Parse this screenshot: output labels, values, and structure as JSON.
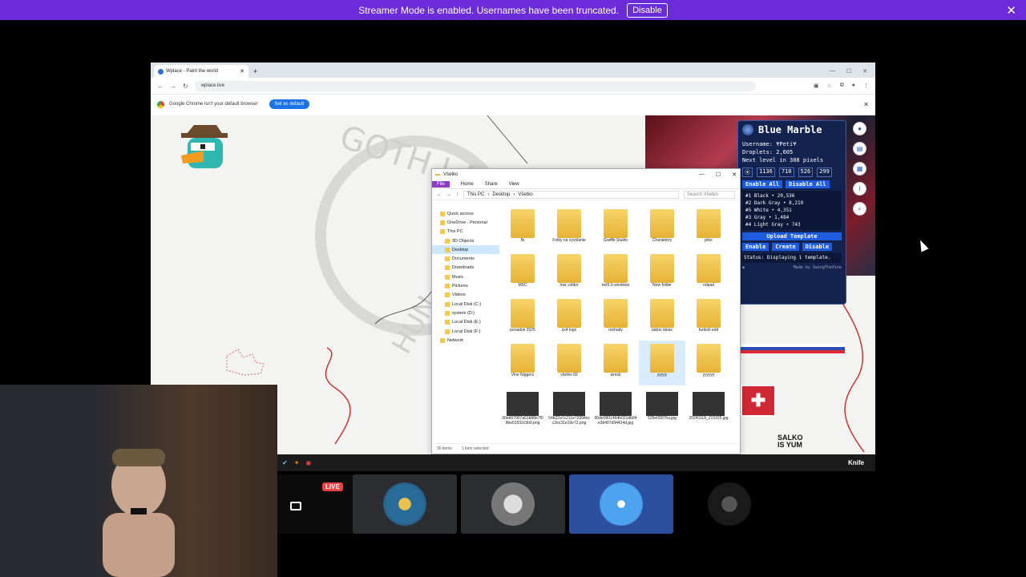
{
  "banner": {
    "text": "Streamer Mode is enabled. Usernames have been truncated.",
    "button": "Disable",
    "close": "✕"
  },
  "browser": {
    "tab_title": "Wplace - Paint the world",
    "url": "wplace.live",
    "infobar_text": "Google Chrome isn't your default browser",
    "infobar_button": "Set as default"
  },
  "map": {
    "watermark_top": "GOTH LAND",
    "watermark_side": "HUN",
    "salko": [
      "SALKO",
      "IS YUM"
    ],
    "crest": "✚"
  },
  "blue_marble": {
    "title": "Blue Marble",
    "username": "Username: ¥Peti¥",
    "droplets": "Droplets: 2,605",
    "next_level": "Next level in 308 pixels",
    "coords": [
      "1136",
      "710",
      "526",
      "299"
    ],
    "enable_all": "Enable All",
    "disable_all": "Disable All",
    "colors": [
      "#1 Black • 20,536",
      "#2 Dark Gray • 8,219",
      "#5 White • 4,351",
      "#3 Gray • 1,484",
      "#4 Light Gray • 743"
    ],
    "upload": "Upload Template",
    "enable": "Enable",
    "create": "Create",
    "disable": "Disable",
    "status": "Status: Displaying 1 template.",
    "footer": "Made by SwingTheVine"
  },
  "explorer": {
    "title": "Všetko",
    "ribbon": [
      "File",
      "Home",
      "Share",
      "View"
    ],
    "path": [
      "This PC",
      "Desktop",
      "Všetko"
    ],
    "search_placeholder": "Search Všetko",
    "sidebar": [
      {
        "label": "Quick access",
        "sub": false,
        "sel": false
      },
      {
        "label": "OneDrive - Personal",
        "sub": false,
        "sel": false
      },
      {
        "label": "This PC",
        "sub": false,
        "sel": false
      },
      {
        "label": "3D Objects",
        "sub": true,
        "sel": false
      },
      {
        "label": "Desktop",
        "sub": true,
        "sel": true
      },
      {
        "label": "Documents",
        "sub": true,
        "sel": false
      },
      {
        "label": "Downloads",
        "sub": true,
        "sel": false
      },
      {
        "label": "Music",
        "sub": true,
        "sel": false
      },
      {
        "label": "Pictures",
        "sub": true,
        "sel": false
      },
      {
        "label": "Videos",
        "sub": true,
        "sel": false
      },
      {
        "label": "Local Disk (C:)",
        "sub": true,
        "sel": false
      },
      {
        "label": "system (D:)",
        "sub": true,
        "sel": false
      },
      {
        "label": "Local Disk (E:)",
        "sub": true,
        "sel": false
      },
      {
        "label": "Local Disk (F:)",
        "sub": true,
        "sel": false
      },
      {
        "label": "Network",
        "sub": false,
        "sel": false
      }
    ],
    "items": [
      {
        "name": "flx",
        "kind": "folder"
      },
      {
        "name": "Fotky na vyvolanie",
        "kind": "folder"
      },
      {
        "name": "Graffiti Studio",
        "kind": "folder"
      },
      {
        "name": "Charaktery",
        "kind": "folder"
      },
      {
        "name": "jebe",
        "kind": "folder"
      },
      {
        "name": "MSC",
        "kind": "folder"
      },
      {
        "name": "msc editor",
        "kind": "folder"
      },
      {
        "name": "net6.0-windows",
        "kind": "folder"
      },
      {
        "name": "New folder",
        "kind": "folder"
      },
      {
        "name": "odpad",
        "kind": "folder"
      },
      {
        "name": "ponadok 2025",
        "kind": "folder"
      },
      {
        "name": "ps4 logo",
        "kind": "folder"
      },
      {
        "name": "reshady",
        "kind": "folder"
      },
      {
        "name": "tattoo ideas",
        "kind": "folder"
      },
      {
        "name": "turkish edit",
        "kind": "folder"
      },
      {
        "name": "Vine Niggerz",
        "kind": "folder"
      },
      {
        "name": "všetko 69",
        "kind": "folder"
      },
      {
        "name": "wreck",
        "kind": "folder"
      },
      {
        "name": "yyyyy",
        "kind": "folder",
        "selected": true
      },
      {
        "name": "yyyyyy",
        "kind": "folder"
      },
      {
        "name": "30eb57907a61b88e7f09be01532c5b9.png",
        "kind": "image"
      },
      {
        "name": "54b22a7c211e73394ccc2ec31e19e72.png",
        "kind": "image"
      },
      {
        "name": "90de0901464b021db04e3b407d94424d.jpg",
        "kind": "image"
      },
      {
        "name": "525e00076a.jpg",
        "kind": "image"
      },
      {
        "name": "20241118_215325.jpg",
        "kind": "image"
      }
    ],
    "status_count": "30 items",
    "status_sel": "1 item selected"
  },
  "taskstrip": {
    "knife": "Knife"
  },
  "tiles": {
    "live": "LIVE"
  }
}
